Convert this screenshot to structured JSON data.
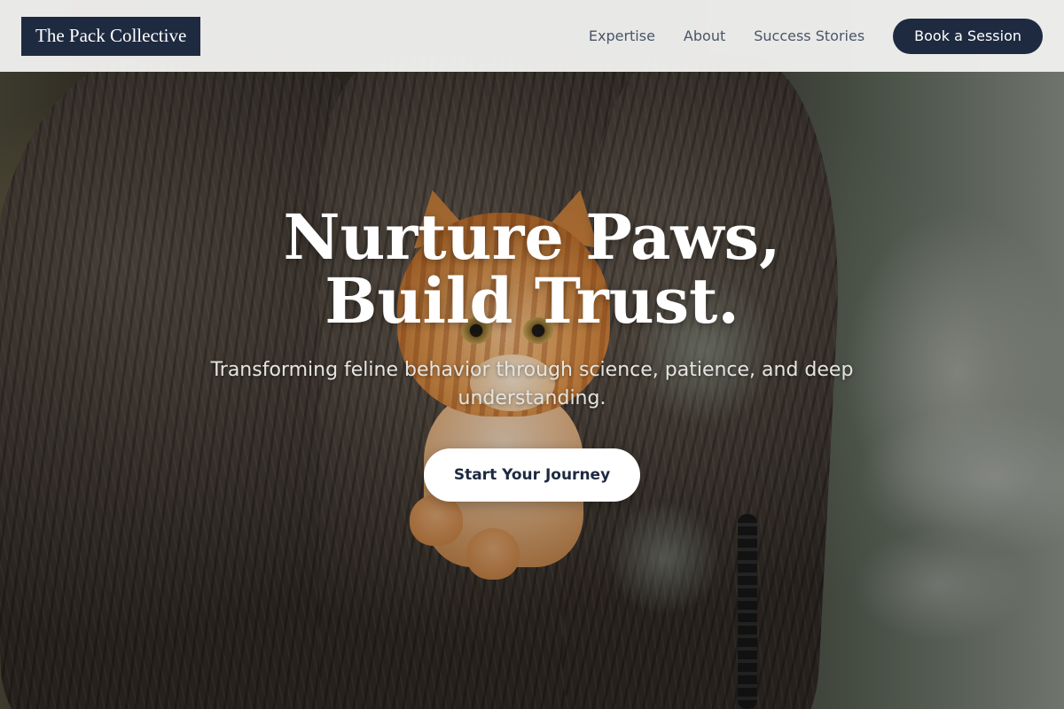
{
  "brand": {
    "name": "The Pack Collective"
  },
  "nav": {
    "links": [
      "Expertise",
      "About",
      "Success Stories"
    ],
    "cta_label": "Book a Session"
  },
  "hero": {
    "title": "Nurture Paws, Build Trust.",
    "subtitle": "Transforming feline behavior through science, patience, and deep understanding.",
    "cta_label": "Start Your Journey",
    "background_image": "orange-tabby-cat-in-tree-trunk"
  },
  "colors": {
    "navy": "#1e2a40",
    "header_bg": "#f0f0ef",
    "nav_text": "#4a5568",
    "white": "#ffffff"
  }
}
